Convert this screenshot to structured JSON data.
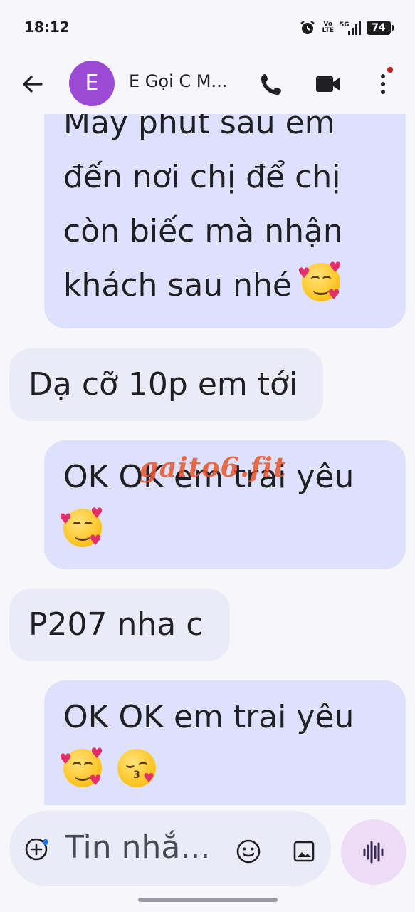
{
  "status_bar": {
    "time": "18:12",
    "volte_label": "Vo\nLTE",
    "network": "5G",
    "battery": "74"
  },
  "app_bar": {
    "avatar_letter": "E",
    "avatar_color": "#9c4ad6",
    "contact_name": "E Gọi C M...",
    "icons": [
      "back-arrow-icon",
      "phone-icon",
      "video-camera-icon",
      "more-vert-icon"
    ]
  },
  "messages": [
    {
      "direction": "outgoing",
      "text": "Mấy phút sau em\nđến nơi chị để chị\ncòn biếc mà nhận\nkhách sau nhé",
      "emojis": [
        "smiling-face-with-hearts"
      ]
    },
    {
      "direction": "incoming",
      "text": "Dạ cỡ 10p em tới",
      "emojis": []
    },
    {
      "direction": "outgoing",
      "text": "OK OK em trai yêu",
      "emojis": [
        "smiling-face-with-hearts"
      ]
    },
    {
      "direction": "incoming",
      "text": "P207 nha c",
      "emojis": []
    },
    {
      "direction": "outgoing",
      "text": "OK OK em trai yêu",
      "emojis": [
        "smiling-face-with-hearts",
        "face-blowing-a-kiss"
      ]
    }
  ],
  "watermark": "gaito6.fit",
  "compose": {
    "placeholder": "Tin nhắ..."
  },
  "colors": {
    "outgoing_bubble": "#dde1fb",
    "incoming_bubble": "#eaebf6",
    "background": "#f6f6fb",
    "voice_button": "#ecdcf6"
  }
}
